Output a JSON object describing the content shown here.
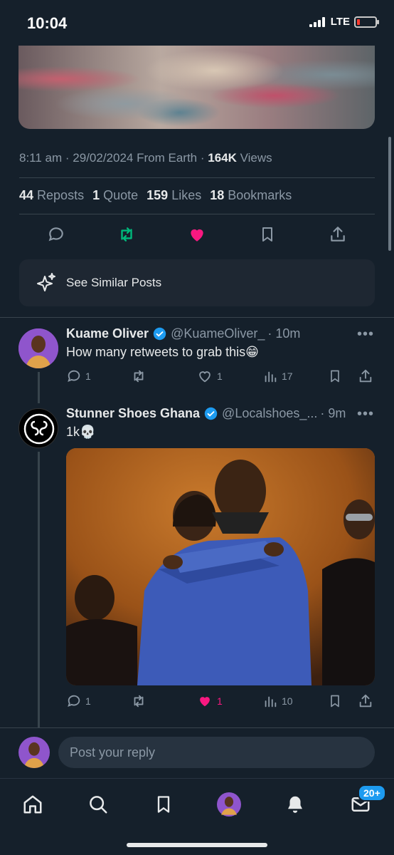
{
  "status_bar": {
    "time": "10:04",
    "network": "LTE"
  },
  "post": {
    "meta": {
      "time": "8:11 am",
      "date": "29/02/2024",
      "source": "From Earth",
      "views_count": "164K",
      "views_label": "Views"
    },
    "stats": {
      "reposts_count": "44",
      "reposts_label": "Reposts",
      "quote_count": "1",
      "quote_label": "Quote",
      "likes_count": "159",
      "likes_label": "Likes",
      "bookmarks_count": "18",
      "bookmarks_label": "Bookmarks"
    },
    "see_similar_label": "See Similar Posts"
  },
  "replies": [
    {
      "name": "Kuame Oliver",
      "handle": "@KuameOliver_",
      "time": "· 10m",
      "text": "How many retweets to grab this😁",
      "reply_count": "1",
      "repost_count": "",
      "like_count": "1",
      "view_count": "17"
    },
    {
      "name": "Stunner Shoes Ghana",
      "handle": "@Localshoes_...",
      "time": "· 9m",
      "text": "1k💀",
      "reply_count": "1",
      "repost_count": "",
      "like_count": "1",
      "view_count": "10"
    }
  ],
  "reply_box": {
    "placeholder": "Post your reply"
  },
  "nav": {
    "messages_badge": "20+"
  },
  "colors": {
    "background": "#15202b",
    "accent": "#1d9bf0",
    "like": "#f91880",
    "repost": "#00ba7c",
    "verified": "#1d9bf0"
  }
}
